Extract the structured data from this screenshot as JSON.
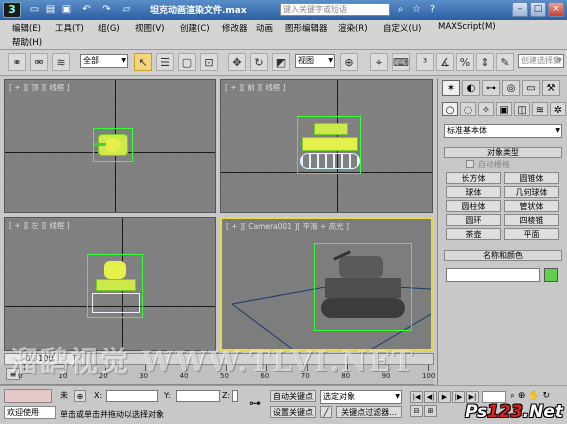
{
  "window": {
    "title": "坦克动画渲染文件.max",
    "search_placeholder": "键入关键字或短语"
  },
  "menus": [
    "编辑(E)",
    "工具(T)",
    "组(G)",
    "视图(V)",
    "创建(C)",
    "修改器",
    "动画",
    "图形编辑器",
    "渲染(R)",
    "自定义(U)",
    "MAXScript(M)",
    "帮助(H)"
  ],
  "toolbar": {
    "selection_filter": "全部",
    "ref_coord": "视图",
    "create_selection_set": "创建选择集"
  },
  "viewports": [
    {
      "label": "[ + ][ 顶 ][ 线框 ]",
      "active": false
    },
    {
      "label": "[ + ][ 前 ][ 线框 ]",
      "active": false
    },
    {
      "label": "[ + ][ 左 ][ 线框 ]",
      "active": false
    },
    {
      "label": "[ + ][ Camera001 ][ 平滑 + 高光 ]",
      "active": true
    }
  ],
  "command_panel": {
    "category_dropdown": "标准基本体",
    "object_type_header": "对象类型",
    "autogrid_label": "自动栅格",
    "buttons": [
      "长方体",
      "圆锥体",
      "球体",
      "几何球体",
      "圆柱体",
      "管状体",
      "圆环",
      "四棱锥",
      "茶壶",
      "平面"
    ],
    "name_color_header": "名称和颜色",
    "object_color": "#5fd14a"
  },
  "timeline": {
    "frame_counter": "0 / 100",
    "tick_labels": [
      "0",
      "10",
      "20",
      "30",
      "40",
      "50",
      "60",
      "70",
      "80",
      "90",
      "100"
    ]
  },
  "status": {
    "welcome": "欢迎使用",
    "selection_status": "未",
    "prompt": "单击或单击并拖动以选择对象",
    "x_label": "X:",
    "y_label": "Y:",
    "z_label": "Z:",
    "auto_key": "自动关键点",
    "set_key": "设置关键点",
    "key_mode_dropdown": "选定对象",
    "key_filters": "关键点过滤器..."
  },
  "watermarks": {
    "left": "溜鹞视觉 WWW.TLVI.NET",
    "right_prefix": "Ps",
    "right_num": "123",
    "right_suffix": ".Net"
  }
}
